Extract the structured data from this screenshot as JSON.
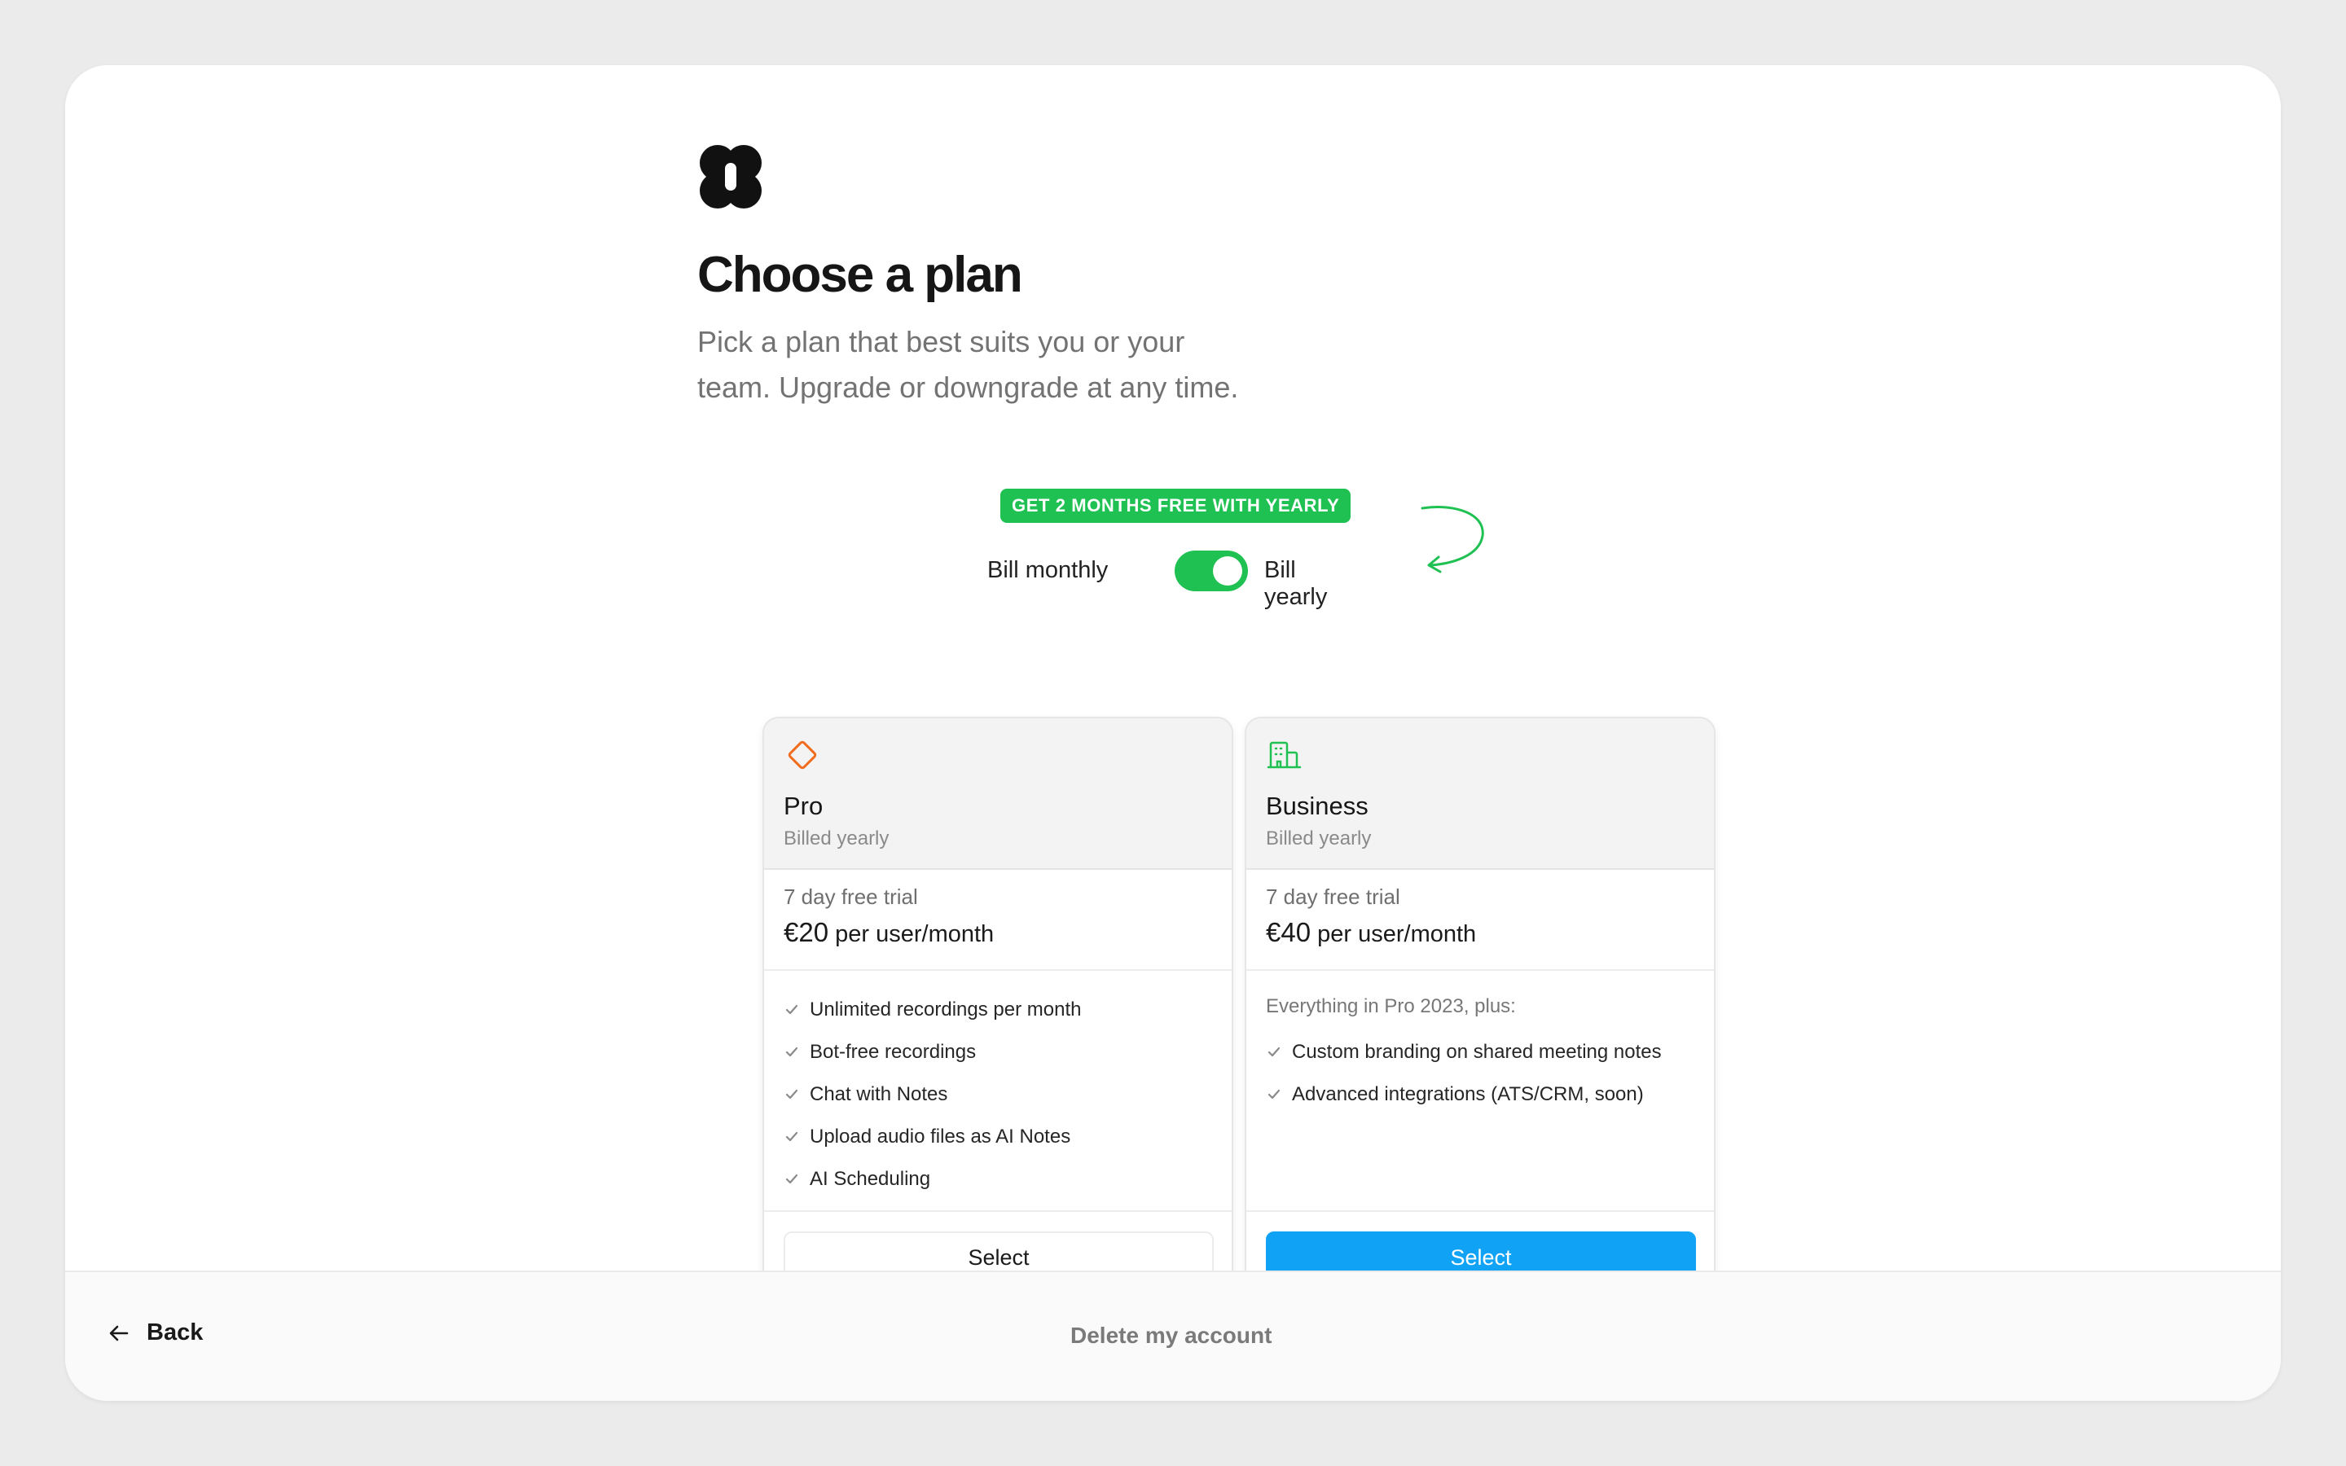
{
  "header": {
    "logo": "app-logo",
    "title": "Choose a plan",
    "subtitle_line1": "Pick a plan that best suits you or your",
    "subtitle_line2": "team. Upgrade or downgrade at any time."
  },
  "billing": {
    "promo": "GET 2 MONTHS FREE WITH YEARLY",
    "monthly_label": "Bill monthly",
    "yearly_label": "Bill yearly",
    "yearly_selected": true
  },
  "plans": [
    {
      "name": "Pro",
      "icon": "diamond-icon",
      "billed": "Billed yearly",
      "trial": "7 day free trial",
      "price": "€20",
      "price_unit": "per user/month",
      "features_intro": "",
      "features": [
        "Unlimited recordings per month",
        "Bot-free recordings",
        "Chat with Notes",
        "Upload audio files as AI Notes",
        "AI Scheduling"
      ],
      "button": "Select"
    },
    {
      "name": "Business",
      "icon": "building-icon",
      "billed": "Billed yearly",
      "trial": "7 day free trial",
      "price": "€40",
      "price_unit": "per user/month",
      "features_intro": "Everything in Pro 2023, plus:",
      "features": [
        "Custom branding on shared meeting notes",
        "Advanced integrations (ATS/CRM, soon)"
      ],
      "button": "Select"
    }
  ],
  "footer": {
    "back_label": "Back",
    "delete_label": "Delete my account"
  },
  "colors": {
    "accent_green": "#1fc152",
    "primary_blue": "#10a3f5",
    "pro_icon": "#f26b1d",
    "business_icon": "#1fc152"
  }
}
